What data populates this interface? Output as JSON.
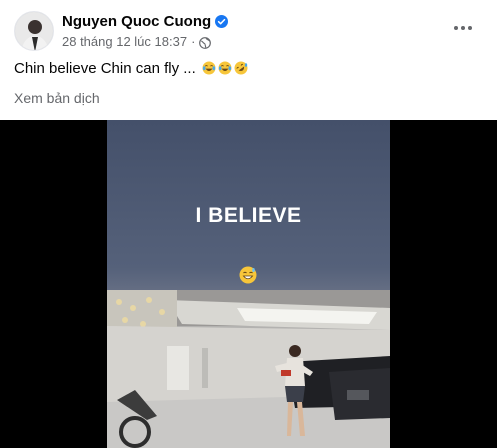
{
  "post": {
    "author": "Nguyen Quoc Cuong",
    "verified": true,
    "timestamp": "28 tháng 12 lúc 18:37",
    "separator": "·",
    "audience_icon": "globe-icon",
    "caption": "Chin believe Chin can fly ... ",
    "caption_emojis": [
      "face-with-tears-of-joy",
      "face-with-tears-of-joy",
      "rolling-on-floor-laughing"
    ],
    "translate_label": "Xem bản dịch",
    "more_icon": "more-options-icon"
  },
  "media": {
    "overlay_text": "I BELIEVE",
    "overlay_emoji": "grinning-sweat-face"
  },
  "colors": {
    "name": "#050505",
    "secondary_text": "#65676b",
    "verified_badge": "#1877f2",
    "media_background": "#000000"
  }
}
